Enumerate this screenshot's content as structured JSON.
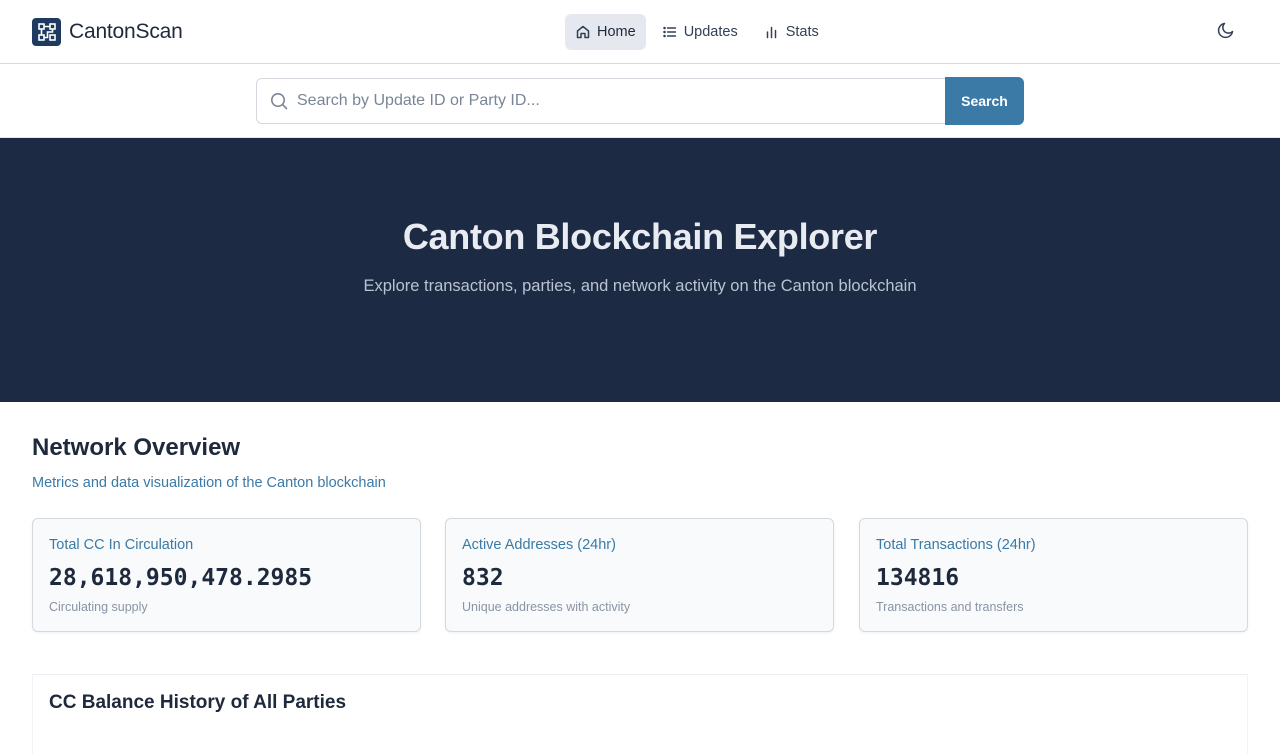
{
  "header": {
    "brand": "CantonScan",
    "nav": [
      {
        "label": "Home",
        "icon": "home-icon",
        "active": true
      },
      {
        "label": "Updates",
        "icon": "list-icon",
        "active": false
      },
      {
        "label": "Stats",
        "icon": "bar-chart-icon",
        "active": false
      }
    ],
    "theme_toggle_icon": "moon-icon"
  },
  "search": {
    "placeholder": "Search by Update ID or Party ID...",
    "value": "",
    "button_label": "Search"
  },
  "hero": {
    "title": "Canton Blockchain Explorer",
    "subtitle": "Explore transactions, parties, and network activity on the Canton blockchain"
  },
  "overview": {
    "title": "Network Overview",
    "subtitle": "Metrics and data visualization of the Canton blockchain",
    "cards": [
      {
        "label": "Total CC In Circulation",
        "value": "28,618,950,478.2985",
        "caption": "Circulating supply"
      },
      {
        "label": "Active Addresses (24hr)",
        "value": "832",
        "caption": "Unique addresses with activity"
      },
      {
        "label": "Total Transactions (24hr)",
        "value": "134816",
        "caption": "Transactions and transfers"
      }
    ]
  },
  "chart_section": {
    "title": "CC Balance History of All Parties"
  },
  "colors": {
    "accent": "#3b7aa6",
    "hero_bg": "#1d2a43",
    "brand_logo": "#1e3a5f"
  }
}
